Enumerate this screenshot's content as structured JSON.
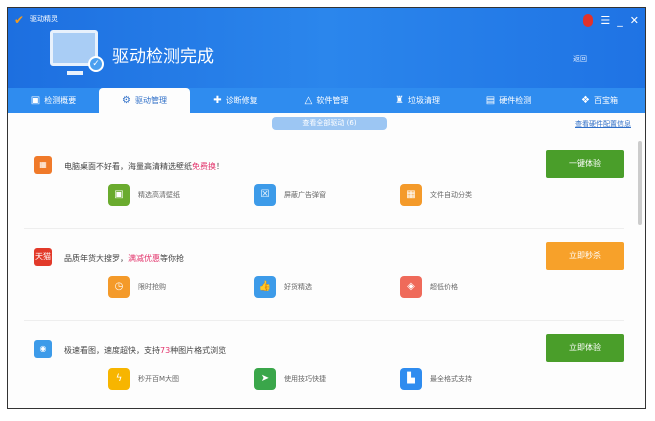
{
  "app": {
    "title": "驱动精灵",
    "status_title": "驱动检测完成",
    "back_label": "返回"
  },
  "tabs": [
    {
      "label": "检测概要",
      "icon": "report-icon"
    },
    {
      "label": "驱动管理",
      "icon": "gear-icon"
    },
    {
      "label": "诊断修复",
      "icon": "repair-icon"
    },
    {
      "label": "软件管理",
      "icon": "software-icon"
    },
    {
      "label": "垃圾清理",
      "icon": "broom-icon"
    },
    {
      "label": "硬件检测",
      "icon": "chart-icon"
    },
    {
      "label": "百宝箱",
      "icon": "box-icon"
    }
  ],
  "subbar": {
    "view_all": "查看全部驱动 (6)",
    "link": "查看硬件配置信息"
  },
  "rows": [
    {
      "desc_pre": "电脑桌面不好看，海量高清精选壁纸",
      "desc_hl": "免费换",
      "desc_post": "！",
      "button": "一键体验",
      "color": "#4a9e2a",
      "icon_color": "#f07a2a",
      "icon_text": "▦",
      "items": [
        {
          "label": "精选高清壁纸",
          "color": "#6aab2e",
          "glyph": "▣"
        },
        {
          "label": "屏蔽广告弹窗",
          "color": "#3d9be9",
          "glyph": "☒"
        },
        {
          "label": "文件自动分类",
          "color": "#f49a2a",
          "glyph": "▦"
        }
      ]
    },
    {
      "desc_pre": "品质年货大搜罗，",
      "desc_hl": "满减优惠",
      "desc_post": "等你抢",
      "button": "立即秒杀",
      "color": "#f7a12a",
      "icon_color": "#e23a2a",
      "icon_text": "天猫",
      "items": [
        {
          "label": "限时抢购",
          "color": "#f49a2a",
          "glyph": "◷"
        },
        {
          "label": "好货精选",
          "color": "#3d9be9",
          "glyph": "👍"
        },
        {
          "label": "超低价格",
          "color": "#ef6a5a",
          "glyph": "◈"
        }
      ]
    },
    {
      "desc_pre": "极速看图，速度超快，支持",
      "desc_hl": "73",
      "desc_post": "种图片格式浏览",
      "button": "立即体验",
      "color": "#4a9e2a",
      "icon_color": "#3d9be9",
      "icon_text": "◉",
      "items": [
        {
          "label": "秒开百M大图",
          "color": "#f7b500",
          "glyph": "ϟ"
        },
        {
          "label": "使用技巧快捷",
          "color": "#3aa64a",
          "glyph": "➤"
        },
        {
          "label": "最全格式支持",
          "color": "#2f8cef",
          "glyph": "▙"
        }
      ]
    }
  ]
}
